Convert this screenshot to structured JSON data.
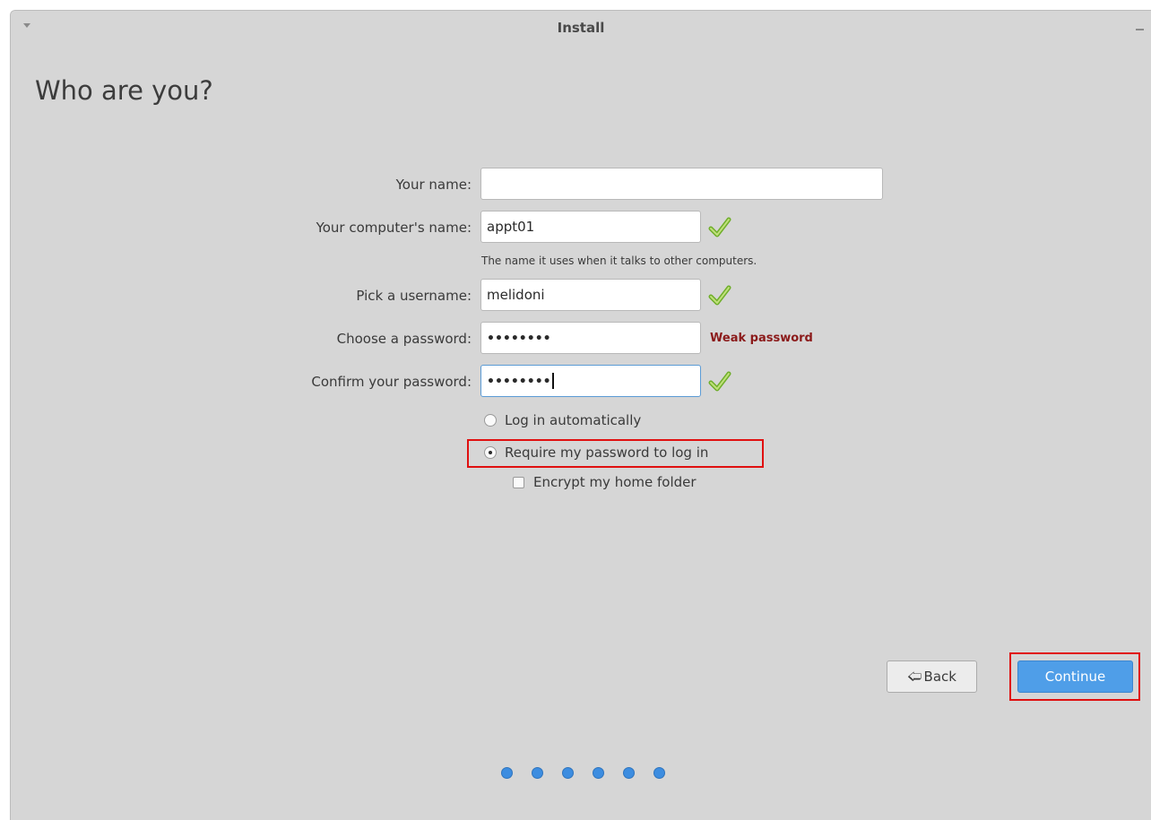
{
  "window": {
    "title": "Install"
  },
  "page": {
    "heading": "Who are you?"
  },
  "form": {
    "your_name": {
      "label": "Your name:",
      "value": ""
    },
    "computer_name": {
      "label": "Your computer's name:",
      "value": "appt01",
      "hint": "The name it uses when it talks to other computers.",
      "status_icon": "check-icon"
    },
    "username": {
      "label": "Pick a username:",
      "value": "melidoni",
      "status_icon": "check-icon"
    },
    "password": {
      "label": "Choose a password:",
      "value": "••••••••",
      "strength": "Weak password"
    },
    "confirm_password": {
      "label": "Confirm your password:",
      "value": "••••••••",
      "status_icon": "check-icon"
    }
  },
  "login_options": {
    "auto_login": {
      "label": "Log in automatically",
      "selected": false
    },
    "require_password": {
      "label": "Require my password to log in",
      "selected": true
    },
    "encrypt_home": {
      "label": "Encrypt my home folder",
      "checked": false
    }
  },
  "buttons": {
    "back": "Back",
    "continue": "Continue"
  },
  "progress": {
    "steps": 6
  },
  "colors": {
    "window_bg": "#d6d6d6",
    "accent": "#4f9ee8",
    "highlight": "#e01010",
    "weak_password": "#8b1a1a",
    "check_green": "#8cc63f"
  }
}
